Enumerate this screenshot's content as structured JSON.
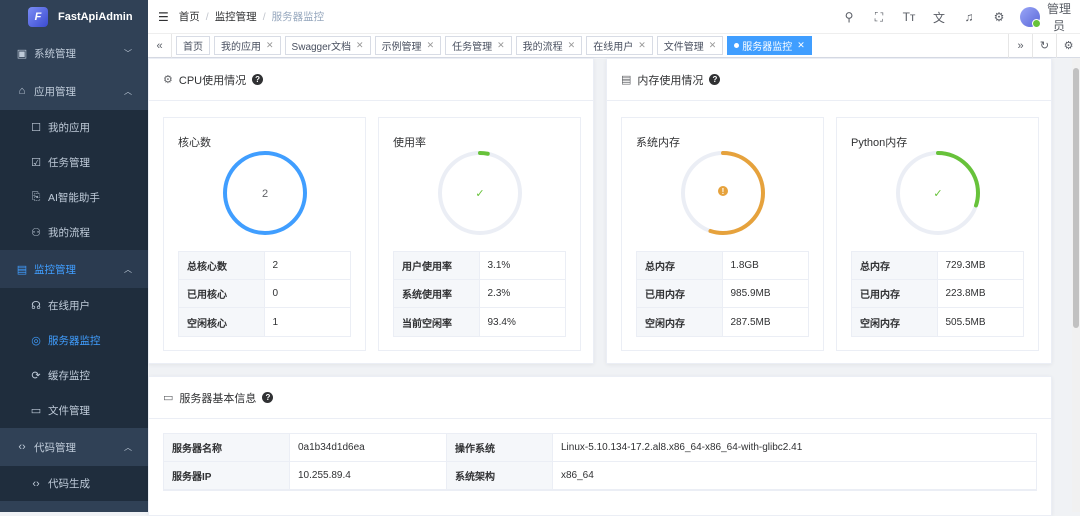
{
  "app": {
    "title": "FastApiAdmin"
  },
  "sidebar": {
    "items": [
      {
        "label": "系统管理",
        "icon": "system-icon"
      },
      {
        "label": "应用管理",
        "icon": "app-icon"
      },
      {
        "label": "我的应用",
        "icon": "myapp-icon"
      },
      {
        "label": "任务管理",
        "icon": "task-icon"
      },
      {
        "label": "AI智能助手",
        "icon": "ai-icon"
      },
      {
        "label": "我的流程",
        "icon": "flow-icon"
      },
      {
        "label": "监控管理",
        "icon": "monitor-icon"
      },
      {
        "label": "在线用户",
        "icon": "headset-icon"
      },
      {
        "label": "服务器监控",
        "icon": "server-icon"
      },
      {
        "label": "缓存监控",
        "icon": "cache-icon"
      },
      {
        "label": "文件管理",
        "icon": "file-icon"
      },
      {
        "label": "代码管理",
        "icon": "code-icon"
      },
      {
        "label": "代码生成",
        "icon": "codegen-icon"
      }
    ]
  },
  "breadcrumb": {
    "home": "首页",
    "parent": "监控管理",
    "current": "服务器监控"
  },
  "user": {
    "name": "管理员"
  },
  "tabs": [
    {
      "label": "首页"
    },
    {
      "label": "我的应用"
    },
    {
      "label": "Swagger文档"
    },
    {
      "label": "示例管理"
    },
    {
      "label": "任务管理"
    },
    {
      "label": "我的流程"
    },
    {
      "label": "在线用户"
    },
    {
      "label": "文件管理"
    },
    {
      "label": "服务器监控"
    }
  ],
  "cpu": {
    "title": "CPU使用情况",
    "cores": {
      "title": "核心数",
      "center": "2",
      "rows": [
        [
          "总核心数",
          "2"
        ],
        [
          "已用核心",
          "0"
        ],
        [
          "空闲核心",
          "1"
        ]
      ]
    },
    "usage": {
      "title": "使用率",
      "percent": 3.1,
      "rows": [
        [
          "用户使用率",
          "3.1%"
        ],
        [
          "系统使用率",
          "2.3%"
        ],
        [
          "当前空闲率",
          "93.4%"
        ]
      ]
    }
  },
  "memory": {
    "title": "内存使用情况",
    "system": {
      "title": "系统内存",
      "percent": 55,
      "rows": [
        [
          "总内存",
          "1.8GB"
        ],
        [
          "已用内存",
          "985.9MB"
        ],
        [
          "空闲内存",
          "287.5MB"
        ]
      ]
    },
    "python": {
      "title": "Python内存",
      "percent": 30,
      "rows": [
        [
          "总内存",
          "729.3MB"
        ],
        [
          "已用内存",
          "223.8MB"
        ],
        [
          "空闲内存",
          "505.5MB"
        ]
      ]
    }
  },
  "server": {
    "title": "服务器基本信息",
    "rows": [
      [
        "服务器名称",
        "0a1b34d1d6ea",
        "操作系统",
        "Linux-5.10.134-17.2.al8.x86_64-x86_64-with-glibc2.41"
      ],
      [
        "服务器IP",
        "10.255.89.4",
        "系统架构",
        "x86_64"
      ]
    ]
  },
  "colors": {
    "blue": "#409eff",
    "orange": "#e6a23c",
    "green": "#67c23a",
    "sidebar": "#304156"
  }
}
